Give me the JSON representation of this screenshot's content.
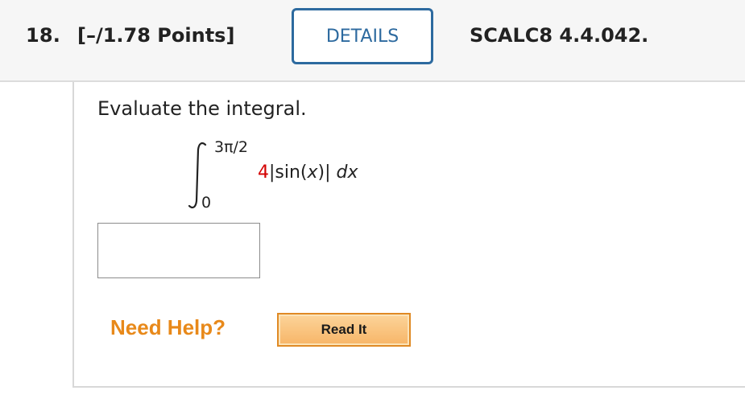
{
  "question": {
    "number": "18.",
    "points": "[–/1.78 Points]",
    "details_label": "DETAILS",
    "code": "SCALC8 4.4.042."
  },
  "problem": {
    "instruction": "Evaluate the integral.",
    "upper_limit": "3π/2",
    "lower_limit": "0",
    "coefficient": "4",
    "expr_open": "|sin(",
    "variable": "x",
    "expr_close": ")| ",
    "differential": "dx"
  },
  "answer": {
    "value": ""
  },
  "help": {
    "need_help_label": "Need Help?",
    "read_it_label": "Read It"
  },
  "colors": {
    "accent_blue": "#2d6a9f",
    "coefficient_red": "#d40000",
    "help_orange": "#e8891a",
    "button_orange": "#f7b567"
  }
}
